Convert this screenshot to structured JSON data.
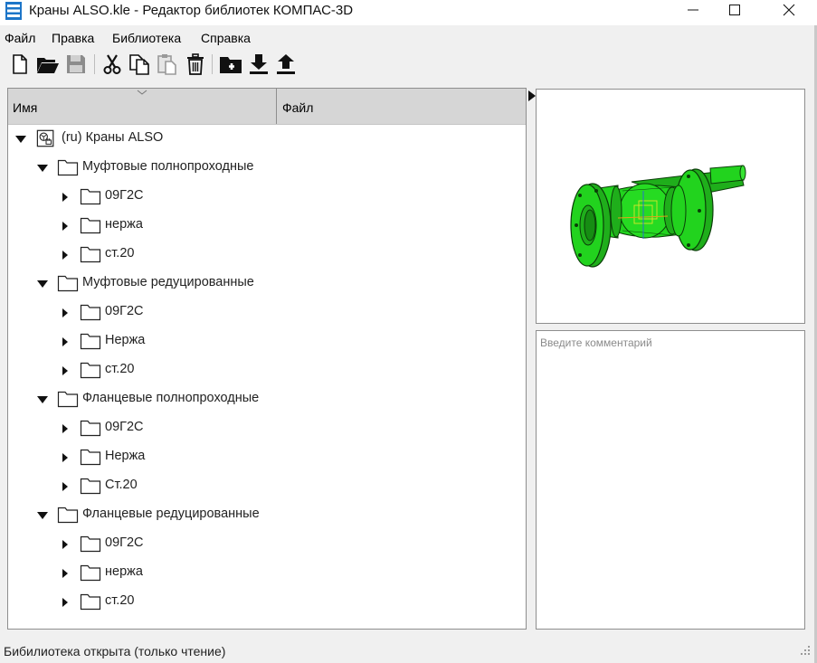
{
  "window": {
    "title": "Краны ALSO.kle - Редактор библиотек КОМПАС-3D",
    "app_icon": "library-app-icon",
    "controls": [
      "minimize-icon",
      "maximize-icon",
      "close-icon"
    ]
  },
  "menu": {
    "file": "Файл",
    "edit": "Правка",
    "library": "Библиотека",
    "help": "Справка"
  },
  "toolbar": {
    "icons": [
      "new-file-icon",
      "open-folder-icon",
      "save-icon",
      "cut-icon",
      "copy-icon",
      "paste-icon",
      "delete-icon",
      "add-folder-icon",
      "import-icon",
      "export-icon"
    ]
  },
  "tree": {
    "columns": {
      "name": "Имя",
      "file": "Файл"
    },
    "root": {
      "label": "(ru) Краны ALSO",
      "icon": "library-root-icon",
      "expanded": true
    },
    "groups": [
      {
        "label": "Муфтовые полнопроходные",
        "expanded": true,
        "children": [
          "09Г2С",
          "нержа",
          "ст.20"
        ]
      },
      {
        "label": "Муфтовые редуцированные",
        "expanded": true,
        "children": [
          "09Г2С",
          "Нержа",
          "ст.20"
        ]
      },
      {
        "label": "Фланцевые полнопроходные",
        "expanded": true,
        "children": [
          "09Г2С",
          "Нержа",
          "Ст.20"
        ]
      },
      {
        "label": "Фланцевые редуцированные",
        "expanded": true,
        "children": [
          "09Г2С",
          "нержа",
          "ст.20"
        ]
      }
    ]
  },
  "preview": {
    "model_color": "#22d31e",
    "edge_color": "#0a3d08"
  },
  "comment": {
    "placeholder": "Введите комментарий"
  },
  "status": {
    "text": "Бибилиотека открыта (только чтение)"
  }
}
